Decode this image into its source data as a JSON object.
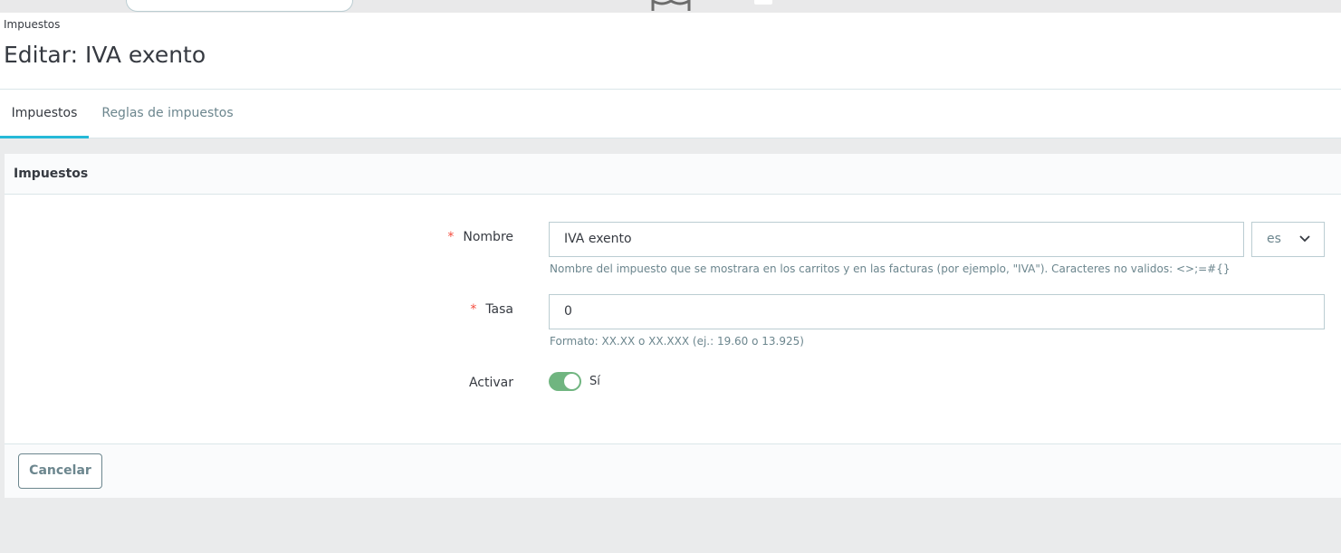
{
  "breadcrumb": "Impuestos",
  "page_title": "Editar: IVA exento",
  "tabs": [
    {
      "label": "Impuestos",
      "active": true
    },
    {
      "label": "Reglas de impuestos",
      "active": false
    }
  ],
  "card": {
    "title": "Impuestos",
    "required_mark": "*",
    "fields": {
      "name": {
        "label": "Nombre",
        "value": "IVA exento",
        "language": "es",
        "help": "Nombre del impuesto que se mostrara en los carritos y en las facturas (por ejemplo, \"IVA\"). Caracteres no validos: <>;=#{}"
      },
      "rate": {
        "label": "Tasa",
        "value": "0",
        "help": "Formato: XX.XX o XX.XXX (ej.: 19.60 o 13.925)"
      },
      "active": {
        "label": "Activar",
        "state_label": "Sí",
        "enabled": true
      }
    },
    "cancel_label": "Cancelar"
  },
  "colors": {
    "accent": "#25b9d7",
    "switch_on": "#70b580",
    "required": "#f54c3e"
  }
}
